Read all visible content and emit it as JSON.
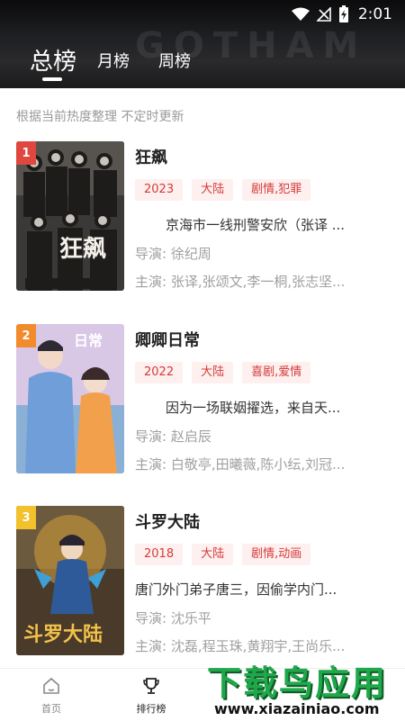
{
  "status_bar": {
    "time": "2:01"
  },
  "tabs": [
    "总榜",
    "月榜",
    "周榜"
  ],
  "subtitle": "根据当前热度整理 不定时更新",
  "items": [
    {
      "rank": "1",
      "rank_color": "#e0473f",
      "title": "狂飙",
      "tags": [
        "2023",
        "大陆",
        "剧情,犯罪"
      ],
      "desc": "京海市一线刑警安欣（张译 ...",
      "director_label": "导演:",
      "director": "徐纪周",
      "cast_label": "主演:",
      "cast": "张译,张颂文,李一桐,张志坚..."
    },
    {
      "rank": "2",
      "rank_color": "#f28b2c",
      "title": "卿卿日常",
      "tags": [
        "2022",
        "大陆",
        "喜剧,爱情"
      ],
      "desc": "因为一场联姻擢选，来自天...",
      "director_label": "导演:",
      "director": "赵启辰",
      "cast_label": "主演:",
      "cast": "白敬亭,田曦薇,陈小纭,刘冠..."
    },
    {
      "rank": "3",
      "rank_color": "#f2c12c",
      "title": "斗罗大陆",
      "tags": [
        "2018",
        "大陆",
        "剧情,动画"
      ],
      "desc": "唐门外门弟子唐三，因偷学内门...",
      "director_label": "导演:",
      "director": "沈乐平",
      "cast_label": "主演:",
      "cast": "沈磊,程玉珠,黄翔宇,王尚乐..."
    }
  ],
  "bottom_nav": [
    {
      "label": "首页",
      "icon": "home-icon"
    },
    {
      "label": "排行榜",
      "icon": "trophy-icon"
    }
  ],
  "watermark": {
    "brand": "下载鸟应用",
    "url": "www.xiazainiao.com"
  },
  "colors": {
    "tag_bg": "#fdf0ef",
    "tag_text": "#d63a3a",
    "header_bg": "#1e1f22"
  }
}
